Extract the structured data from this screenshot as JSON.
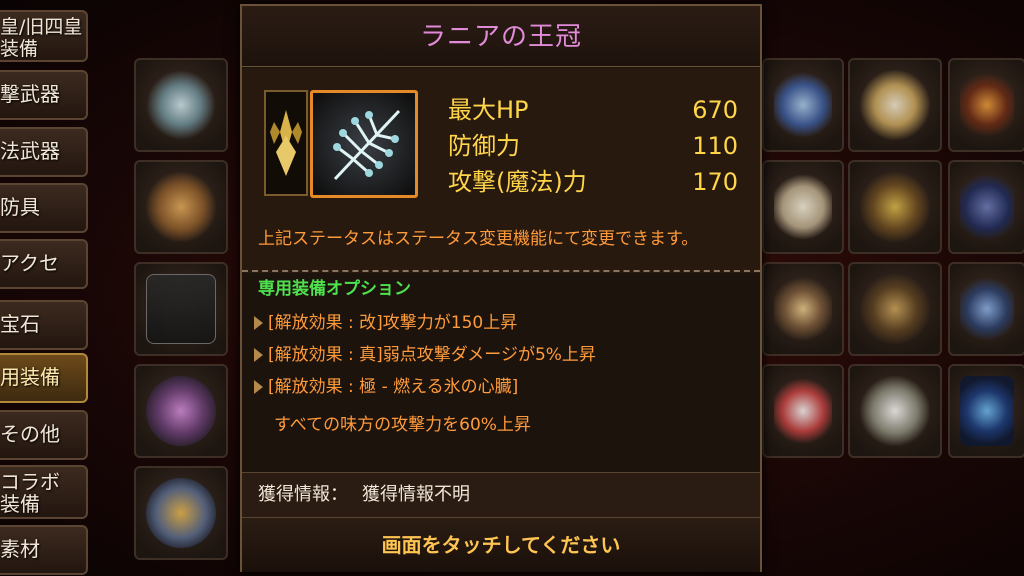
{
  "sidebar": {
    "items": [
      {
        "label": "皇/旧四皇\n装備"
      },
      {
        "label": "撃武器"
      },
      {
        "label": "法武器"
      },
      {
        "label": "防具"
      },
      {
        "label": "アクセ"
      },
      {
        "label": "宝石"
      },
      {
        "label": "用装備"
      },
      {
        "label": "その他"
      },
      {
        "label": "コラボ\n装備"
      },
      {
        "label": "素材"
      }
    ]
  },
  "modal": {
    "title": "ラニアの王冠",
    "stats": [
      {
        "label": "最大HP",
        "value": "670"
      },
      {
        "label": "防御力",
        "value": "110"
      },
      {
        "label": "攻撃(魔法)力",
        "value": "170"
      }
    ],
    "note": "上記ステータスはステータス変更機能にて変更できます。",
    "options_header": "専用装備オプション",
    "options": [
      {
        "text": "[解放効果 : 改]攻撃力が150上昇"
      },
      {
        "text": "[解放効果 : 真]弱点攻撃ダメージが5%上昇"
      },
      {
        "text": "[解放効果 : 極 - 燃える氷の心臓]"
      }
    ],
    "option_sub": "すべての味方の攻撃力を60%上昇",
    "acquisition_label": "獲得情報：",
    "acquisition_value": "獲得情報不明",
    "touch_prompt": "画面をタッチしてください"
  },
  "colors": {
    "title": "#e18ad8",
    "stat": "#ffd54a",
    "option_text": "#ff9b3a",
    "option_header": "#4ee24e",
    "frame_border": "#e48a26"
  }
}
